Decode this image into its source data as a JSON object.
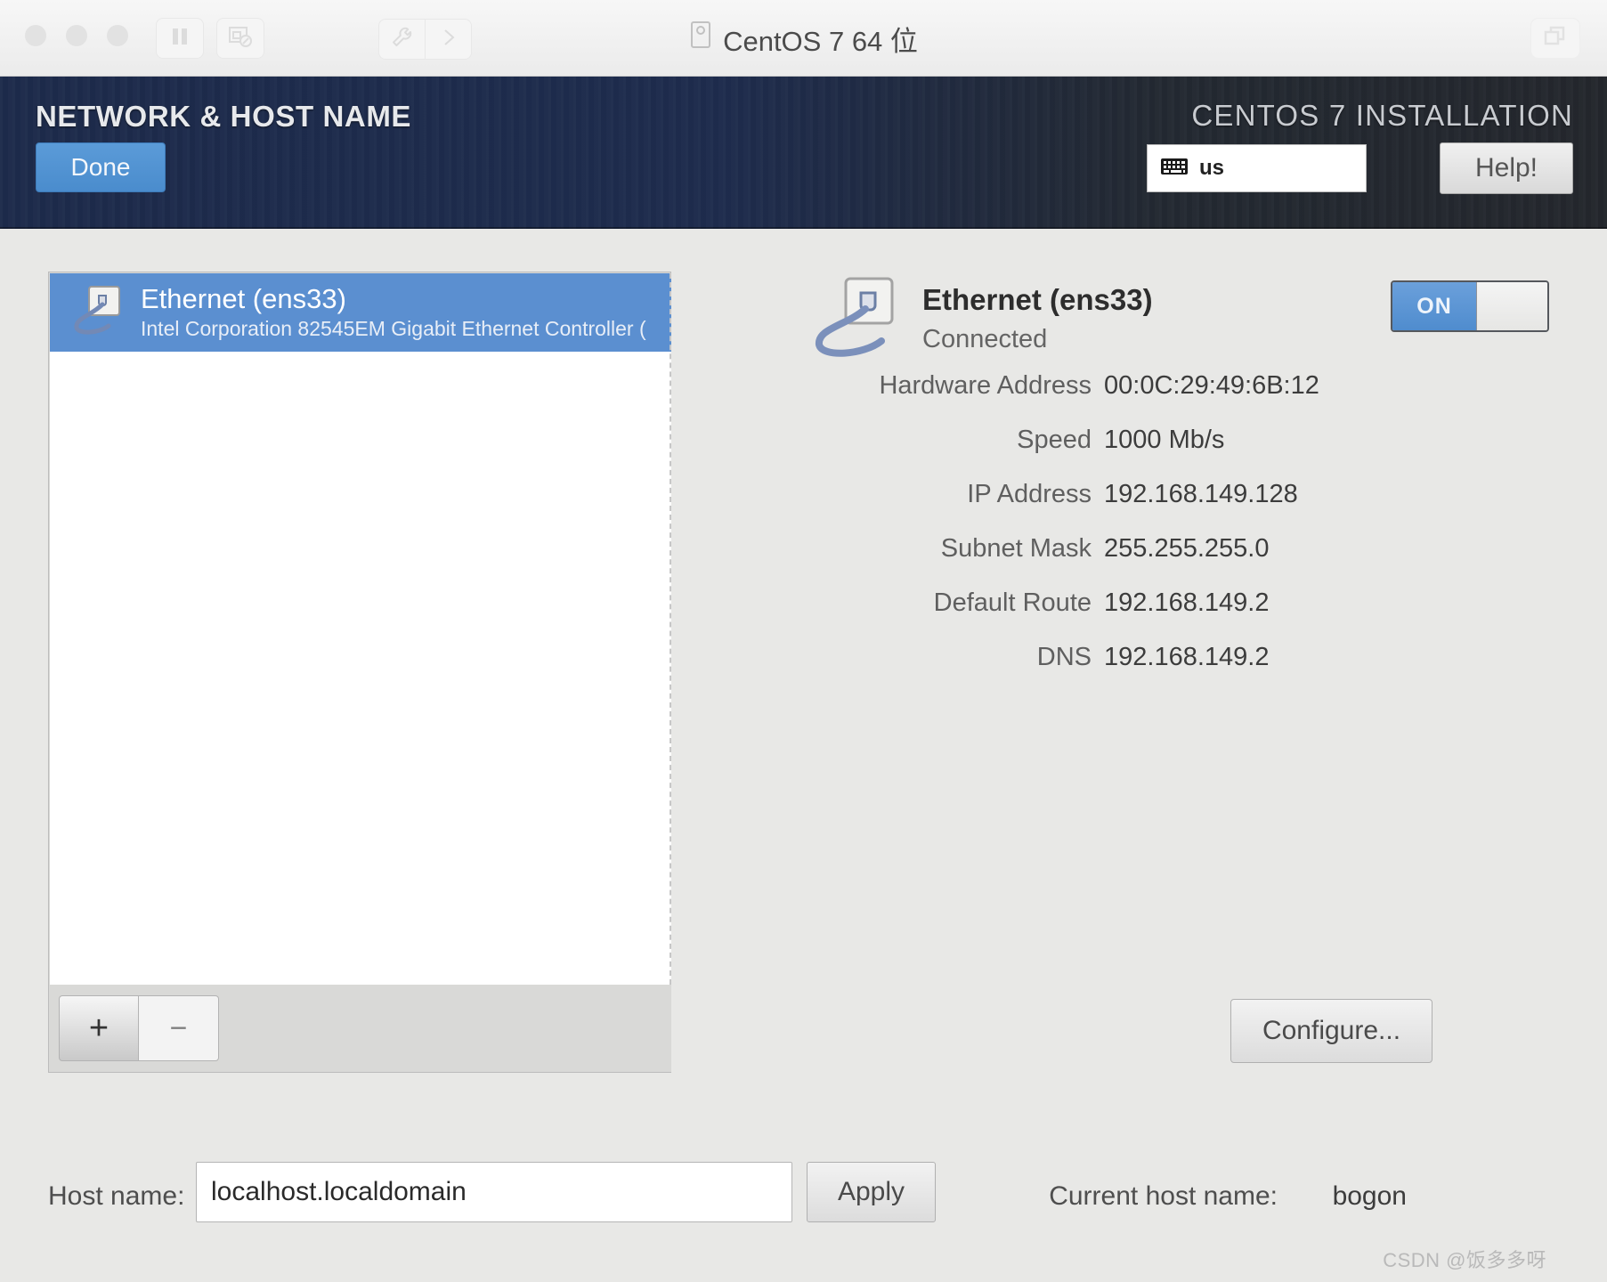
{
  "window": {
    "title": "CentOS 7 64 位",
    "titlebar_icons": [
      "traffic-light-close",
      "traffic-light-minimize",
      "traffic-light-maximize",
      "pause-icon",
      "snapshot-icon",
      "wrench-icon",
      "chevron-right-icon",
      "window-restore-icon"
    ]
  },
  "header": {
    "spoke_title": "NETWORK & HOST NAME",
    "done_label": "Done",
    "install_title": "CENTOS 7 INSTALLATION",
    "keyboard_layout": "us",
    "keyboard_icon": "keyboard-icon",
    "help_label": "Help!",
    "accent_blue": "#4a8ccd",
    "header_bg": "#1d2b4b"
  },
  "device_list": {
    "items": [
      {
        "icon": "wired-network-icon",
        "name": "Ethernet (ens33)",
        "description": "Intel Corporation 82545EM Gigabit Ethernet Controller (",
        "selected": true
      }
    ],
    "add_label": "+",
    "remove_label": "−"
  },
  "detail": {
    "icon": "wired-network-icon",
    "name": "Ethernet (ens33)",
    "state": "Connected",
    "toggle_label": "ON",
    "toggle_on": true,
    "rows": [
      {
        "key": "Hardware Address",
        "value": "00:0C:29:49:6B:12"
      },
      {
        "key": "Speed",
        "value": "1000 Mb/s"
      },
      {
        "key": "IP Address",
        "value": "192.168.149.128"
      },
      {
        "key": "Subnet Mask",
        "value": "255.255.255.0"
      },
      {
        "key": "Default Route",
        "value": "192.168.149.2"
      },
      {
        "key": "DNS",
        "value": "192.168.149.2"
      }
    ],
    "configure_label": "Configure..."
  },
  "bottom": {
    "hostname_label": "Host name:",
    "hostname_value": "localhost.localdomain",
    "apply_label": "Apply",
    "current_host_label": "Current host name:",
    "current_host_value": "bogon"
  },
  "watermark": "CSDN @饭多多呀"
}
